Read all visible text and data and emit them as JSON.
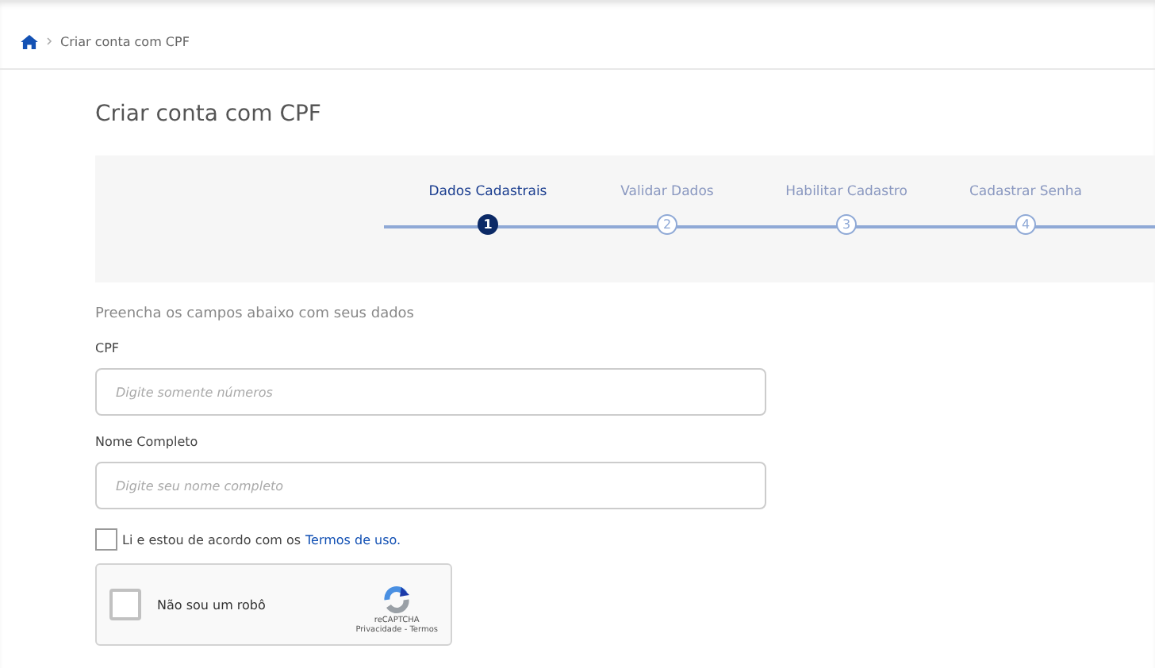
{
  "breadcrumb": {
    "current": "Criar conta com CPF"
  },
  "page_title": "Criar conta com CPF",
  "steps": [
    {
      "label": "Dados Cadastrais",
      "number": "1",
      "selected": true
    },
    {
      "label": "Validar Dados",
      "number": "2",
      "selected": false
    },
    {
      "label": "Habilitar Cadastro",
      "number": "3",
      "selected": false
    },
    {
      "label": "Cadastrar Senha",
      "number": "4",
      "selected": false
    }
  ],
  "instructions": "Preencha os campos abaixo com seus dados",
  "fields": [
    {
      "label": "CPF",
      "placeholder": "Digite somente números"
    },
    {
      "label": "Nome Completo",
      "placeholder": "Digite seu nome completo"
    }
  ],
  "terms": {
    "text": "Li e estou de acordo com os",
    "link": "Termos de uso.",
    "checked": false
  },
  "captcha": {
    "label": "Não sou um robô",
    "brand": "reCAPTCHA",
    "links": "Privacidade - Termos",
    "checked": false
  }
}
